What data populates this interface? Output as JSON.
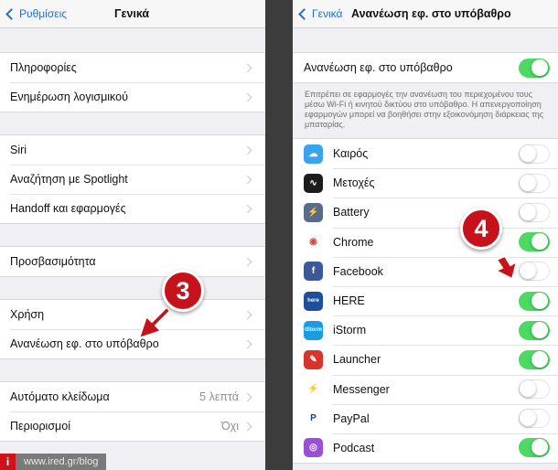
{
  "left": {
    "nav": {
      "back_label": "Ρυθμίσεις",
      "title": "Γενικά"
    },
    "groups": [
      {
        "rows": [
          {
            "label": "Πληροφορίες"
          },
          {
            "label": "Ενημέρωση λογισμικού"
          }
        ]
      },
      {
        "rows": [
          {
            "label": "Siri"
          },
          {
            "label": "Αναζήτηση με Spotlight"
          },
          {
            "label": "Handoff και εφαρμογές"
          }
        ]
      },
      {
        "rows": [
          {
            "label": "Προσβασιμότητα"
          }
        ]
      },
      {
        "rows": [
          {
            "label": "Χρήση"
          },
          {
            "label": "Ανανέωση εφ. στο υπόβαθρο"
          }
        ]
      },
      {
        "rows": [
          {
            "label": "Αυτόματο κλείδωμα",
            "value": "5 λεπτά"
          },
          {
            "label": "Περιορισμοί",
            "value": "Όχι"
          }
        ]
      }
    ],
    "badge": "3"
  },
  "right": {
    "nav": {
      "back_label": "Γενικά",
      "title": "Ανανέωση εφ. στο υπόβαθρο"
    },
    "master": {
      "label": "Ανανέωση εφ. στο υπόβαθρο",
      "on": true
    },
    "footnote": "Επιτρέπει σε εφαρμογές την ανανέωση του περιεχομένου τους μέσω Wi-Fi ή κινητού δικτύου στο υπόβαθρο. Η απενεργοποίηση εφαρμογών μπορεί να βοηθήσει στην εξοικονόμηση διάρκειας της μπαταρίας.",
    "apps": [
      {
        "label": "Καιρός",
        "icon": "weather-icon",
        "color": "#3aa3f0",
        "glyph": "☁",
        "on": false
      },
      {
        "label": "Μετοχές",
        "icon": "stocks-icon",
        "color": "#1c1c1c",
        "glyph": "∿",
        "on": false
      },
      {
        "label": "Battery",
        "icon": "battery-app-icon",
        "color": "#5a6a8a",
        "glyph": "⚡",
        "on": false
      },
      {
        "label": "Chrome",
        "icon": "chrome-icon",
        "color": "#ffffff",
        "glyph": "◉",
        "on": true
      },
      {
        "label": "Facebook",
        "icon": "facebook-icon",
        "color": "#3b5998",
        "glyph": "f",
        "on": false
      },
      {
        "label": "HERE",
        "icon": "here-icon",
        "color": "#1d4f9a",
        "glyph": "here",
        "on": true
      },
      {
        "label": "iStorm",
        "icon": "istorm-icon",
        "color": "#1c9ce0",
        "glyph": "iStorm",
        "on": true
      },
      {
        "label": "Launcher",
        "icon": "launcher-icon",
        "color": "#d8342c",
        "glyph": "✎",
        "on": true
      },
      {
        "label": "Messenger",
        "icon": "messenger-icon",
        "color": "#ffffff",
        "glyph": "⚡",
        "on": false
      },
      {
        "label": "PayPal",
        "icon": "paypal-icon",
        "color": "#ffffff",
        "glyph": "P",
        "on": false
      },
      {
        "label": "Podcast",
        "icon": "podcast-icon",
        "color": "#9b4fd6",
        "glyph": "◎",
        "on": true
      }
    ],
    "badge": "4"
  },
  "watermark": {
    "logo": "i",
    "text": "www.ired.gr/blog"
  },
  "colors": {
    "ios_blue": "#1f6ed4",
    "toggle_on": "#4cd964",
    "badge_red": "#c8121b"
  }
}
